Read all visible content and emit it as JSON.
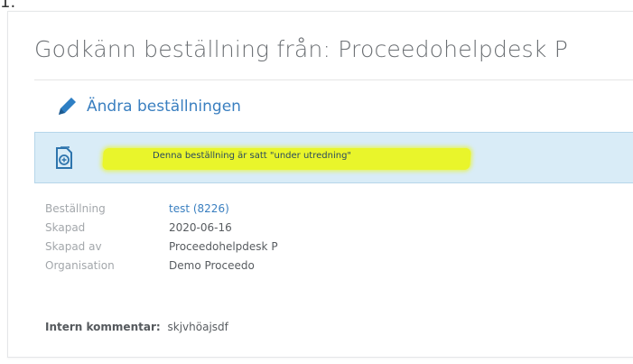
{
  "stray_mark": "1.",
  "header": {
    "title": "Godkänn beställning från: Proceedohelpdesk P"
  },
  "actions": {
    "edit_label": "Ändra beställningen"
  },
  "alert": {
    "message": "Denna beställning är satt \"under utredning\"",
    "icon": "document-currency-icon"
  },
  "details": [
    {
      "key": "Beställning",
      "value": "test (8226)"
    },
    {
      "key": "Skapad",
      "value": "2020-06-16"
    },
    {
      "key": "Skapad av",
      "value": "Proceedohelpdesk P"
    },
    {
      "key": "Organisation",
      "value": "Demo Proceedo"
    }
  ],
  "comment": {
    "label": "Intern kommentar:",
    "value": "skjvhöajsdf"
  },
  "colors": {
    "link": "#3a7fc0",
    "alert_bg": "#d9ecf7",
    "highlight": "#e9f52b"
  }
}
